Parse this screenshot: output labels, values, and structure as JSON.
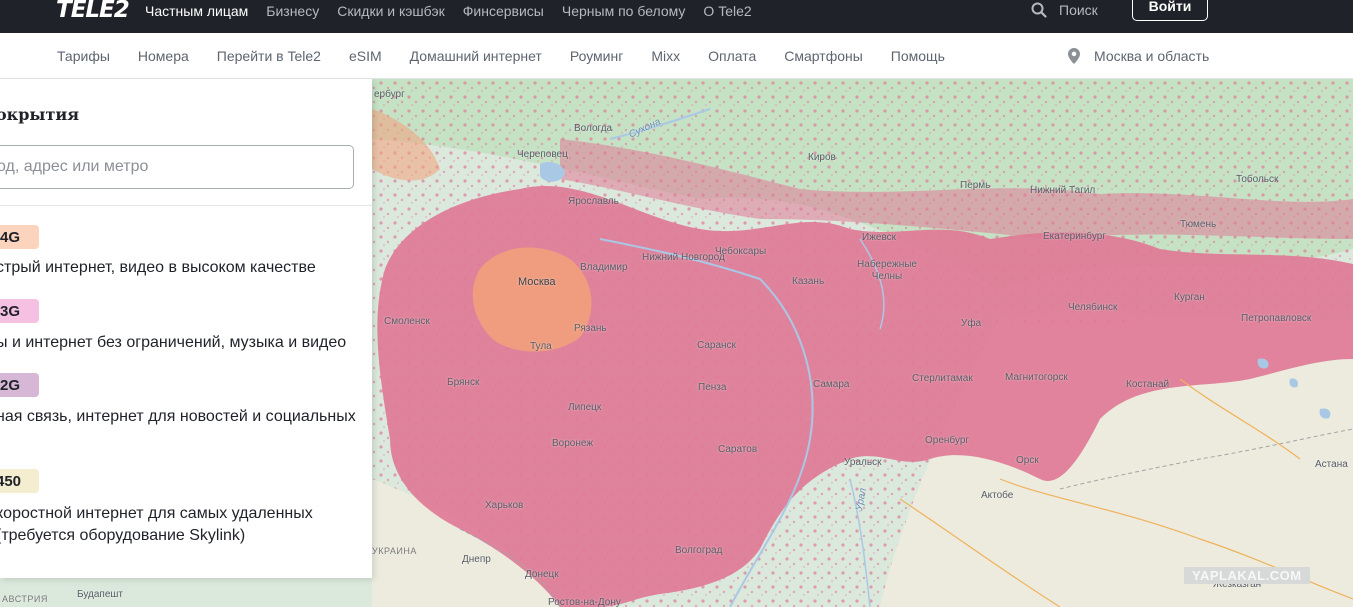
{
  "header": {
    "logo": "TELE2",
    "nav": [
      "Частным лицам",
      "Бизнесу",
      "Скидки и кэшбэк",
      "Финсервисы",
      "Черным по белому",
      "О Tele2"
    ],
    "active_nav": "Частным лицам",
    "search_label": "Поиск",
    "login_label": "Войти"
  },
  "subnav": {
    "items": [
      "Тарифы",
      "Номера",
      "Перейти в Tele2",
      "eSIM",
      "Домашний интернет",
      "Роуминг",
      "Mixx",
      "Оплата",
      "Смартфоны",
      "Помощь"
    ],
    "region": "Москва и область"
  },
  "panel": {
    "title": "окрытия",
    "search_placeholder": "од, адрес или метро",
    "legend": [
      {
        "badge": "4G",
        "color": "#fcd3bc",
        "text": "стрый интернет, видео в высоком качестве"
      },
      {
        "badge": "3G",
        "color": "#f6c0e2",
        "text": "ы и интернет без ограничений, музыка и видео"
      },
      {
        "badge": "2G",
        "color": "#d7b7d6",
        "text_line1": "ная связь, интернет для новостей и социальных"
      },
      {
        "badge": " 450",
        "color": "#f5edcf",
        "text_line1": "коростной интернет для самых удаленных",
        "text_line2": "(требуется оборудование Skylink)"
      }
    ]
  },
  "map": {
    "colors": {
      "land": "#dbe9dc",
      "forest": "#c6e2c5",
      "steppe": "#ecebde",
      "coverage": "#e07a96",
      "coverage_4g": "#f2a07c",
      "water": "#a9c8e6"
    },
    "cities": [
      "ербург",
      "Вологда",
      "Череповец",
      "Киров",
      "Пермь",
      "Нижний Тагил",
      "Тобольск",
      "Ярославль",
      "Ижевск",
      "Екатеринбург",
      "Тюмень",
      "Владимир",
      "Нижний Новгород",
      "Чебоксары",
      "Набережные Челны",
      "Москва",
      "Казань",
      "Смоленск",
      "Рязань",
      "Саранск",
      "Уфа",
      "Челябинск",
      "Курган",
      "Петропавловск",
      "Тула",
      "Брянск",
      "Пенза",
      "Самара",
      "Стерлитамак",
      "Магнитогорск",
      "Костанай",
      "Липецк",
      "Воронеж",
      "Саратов",
      "Оренбург",
      "Орск",
      "Уральск",
      "Астана",
      "Актобе",
      "Харьков",
      "УКРАИНА",
      "Днепр",
      "Донецк",
      "Волгоград",
      "Будапешт",
      "АВСТРИЯ",
      "Ростов-на-Дону",
      "Жезказган",
      "Сухона",
      "Урал"
    ],
    "watermark": "YAPLAKAL.COM"
  }
}
